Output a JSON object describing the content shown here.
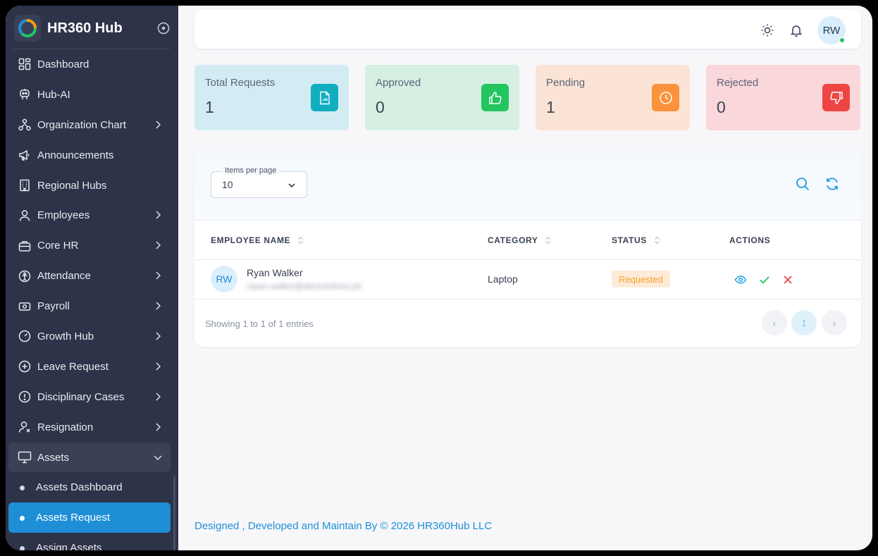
{
  "app": {
    "title": "HR360 Hub"
  },
  "sidebar": {
    "items": [
      {
        "label": "Dashboard",
        "icon": "dashboard-icon",
        "chevron": false
      },
      {
        "label": "Hub-AI",
        "icon": "robot-icon",
        "chevron": false
      },
      {
        "label": "Organization Chart",
        "icon": "org-chart-icon",
        "chevron": true
      },
      {
        "label": "Announcements",
        "icon": "megaphone-icon",
        "chevron": false
      },
      {
        "label": "Regional Hubs",
        "icon": "building-icon",
        "chevron": false
      },
      {
        "label": "Employees",
        "icon": "user-icon",
        "chevron": true
      },
      {
        "label": "Core HR",
        "icon": "briefcase-icon",
        "chevron": true
      },
      {
        "label": "Attendance",
        "icon": "attendance-icon",
        "chevron": true
      },
      {
        "label": "Payroll",
        "icon": "money-icon",
        "chevron": true
      },
      {
        "label": "Growth Hub",
        "icon": "gauge-icon",
        "chevron": true
      },
      {
        "label": "Leave Request",
        "icon": "plus-circle-icon",
        "chevron": true
      },
      {
        "label": "Disciplinary Cases",
        "icon": "alert-circle-icon",
        "chevron": true
      },
      {
        "label": "Resignation",
        "icon": "user-x-icon",
        "chevron": true
      },
      {
        "label": "Assets",
        "icon": "monitor-icon",
        "chevron": true,
        "open": true
      }
    ],
    "sub_items": [
      {
        "label": "Assets Dashboard"
      },
      {
        "label": "Assets Request",
        "active": true
      },
      {
        "label": "Assign Assets"
      }
    ]
  },
  "topbar": {
    "avatar_initials": "RW"
  },
  "stats": [
    {
      "label": "Total Requests",
      "value": "1",
      "bg": "#d3ecf3",
      "icon_bg": "#10aebf",
      "icon": "document-chart-icon"
    },
    {
      "label": "Approved",
      "value": "0",
      "bg": "#d5efe3",
      "icon_bg": "#22c55e",
      "icon": "thumbs-up-icon"
    },
    {
      "label": "Pending",
      "value": "1",
      "bg": "#fbe4d5",
      "icon_bg": "#fb923c",
      "icon": "clock-icon"
    },
    {
      "label": "Rejected",
      "value": "0",
      "bg": "#fad7da",
      "icon_bg": "#ef4444",
      "icon": "thumbs-down-icon"
    }
  ],
  "table": {
    "per_page_label": "Items per page",
    "per_page_value": "10",
    "columns": [
      "EMPLOYEE NAME",
      "CATEGORY",
      "STATUS",
      "ACTIONS"
    ],
    "rows": [
      {
        "initials": "RW",
        "name": "Ryan Walker",
        "email": "rayan.walker@abcsolutions.pk",
        "category": "Laptop",
        "status": "Requested"
      }
    ],
    "info": "Showing 1 to 1 of 1 entries",
    "pages": {
      "prev": "‹",
      "current": "1",
      "next": "›"
    }
  },
  "footer": {
    "text": "Designed , Developed and Maintain By © 2026 HR360Hub LLC"
  }
}
